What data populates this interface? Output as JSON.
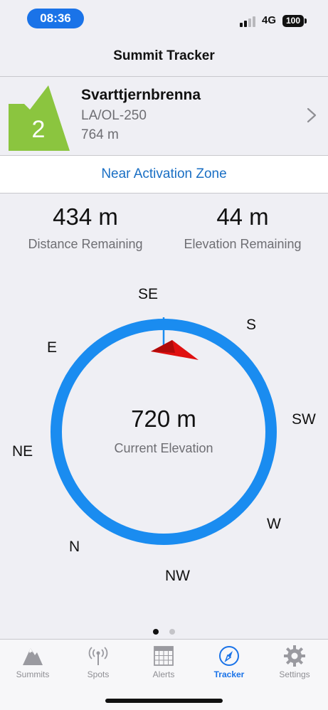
{
  "status_bar": {
    "time": "08:36",
    "network": "4G",
    "battery": "100"
  },
  "nav": {
    "title": "Summit Tracker"
  },
  "summit": {
    "points": "2",
    "name": "Svarttjernbrenna",
    "reference": "LA/OL-250",
    "elevation": "764 m",
    "badge_color": "#8bc53f"
  },
  "zone_status": "Near Activation Zone",
  "stats": {
    "distance_value": "434 m",
    "distance_label": "Distance Remaining",
    "elevation_value": "44 m",
    "elevation_label": "Elevation Remaining"
  },
  "compass": {
    "labels": {
      "se": "SE",
      "s": "S",
      "sw": "SW",
      "w": "W",
      "nw": "NW",
      "n": "N",
      "ne": "NE",
      "e": "E"
    },
    "current_elevation_value": "720 m",
    "current_elevation_label": "Current Elevation",
    "ring_color": "#1a8cf0",
    "pointer_color": "#e01010"
  },
  "pager": {
    "pages": 2,
    "current": 1
  },
  "tabs": [
    {
      "label": "Summits",
      "icon": "mountain-icon",
      "active": false
    },
    {
      "label": "Spots",
      "icon": "antenna-icon",
      "active": false
    },
    {
      "label": "Alerts",
      "icon": "calendar-icon",
      "active": false
    },
    {
      "label": "Tracker",
      "icon": "compass-icon",
      "active": true
    },
    {
      "label": "Settings",
      "icon": "gear-icon",
      "active": false
    }
  ]
}
